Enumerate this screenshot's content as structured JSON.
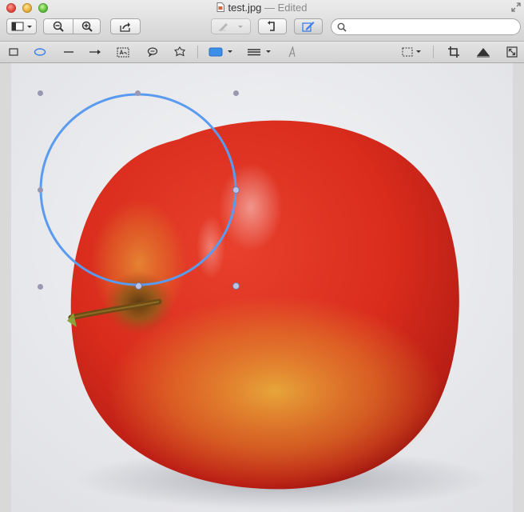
{
  "window": {
    "filename": "test.jpg",
    "status": " — Edited"
  },
  "toolbar": {
    "search": {
      "placeholder": "",
      "value": ""
    }
  },
  "icons": {
    "sidebar": "sidebar-icon",
    "zoom_out": "zoom-out-icon",
    "zoom_in": "zoom-in-icon",
    "share": "share-icon",
    "highlight": "highlight-pen-icon",
    "rotate": "rotate-icon",
    "markup": "markup-toolbox-icon"
  },
  "markup_tools": [
    "rectangle-tool",
    "oval-tool",
    "line-tool",
    "arrow-tool",
    "text-box-tool",
    "speech-bubble-tool",
    "star-tool",
    "border-color-tool",
    "line-style-tool",
    "text-style-tool",
    "selection-tool",
    "crop-tool",
    "adjust-color-tool",
    "resize-tool"
  ],
  "colors": {
    "annotation_stroke": "#5b9bef",
    "accent_blue": "#3c7ee8"
  }
}
